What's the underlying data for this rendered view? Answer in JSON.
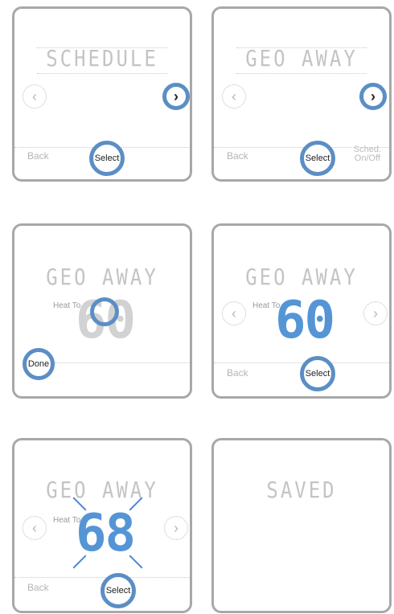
{
  "panels": [
    {
      "title": "SCHEDULE",
      "back": "Back",
      "select": "Select"
    },
    {
      "title": "GEO AWAY",
      "back": "Back",
      "select": "Select",
      "sched": [
        "Sched.",
        "On/Off"
      ]
    },
    {
      "title": "GEO AWAY",
      "heat_to": "Heat To",
      "temp": "60",
      "done": "Done"
    },
    {
      "title": "GEO AWAY",
      "heat_to": "Heat To",
      "temp": "60",
      "back": "Back",
      "select": "Select"
    },
    {
      "title": "GEO AWAY",
      "heat_to": "Heat To",
      "temp": "68",
      "back": "Back",
      "select": "Select"
    },
    {
      "title": "SAVED"
    }
  ],
  "icons": {
    "left": "‹",
    "right": "›"
  },
  "colors": {
    "accent": "#5b8ec4",
    "digit": "#5595d6"
  }
}
